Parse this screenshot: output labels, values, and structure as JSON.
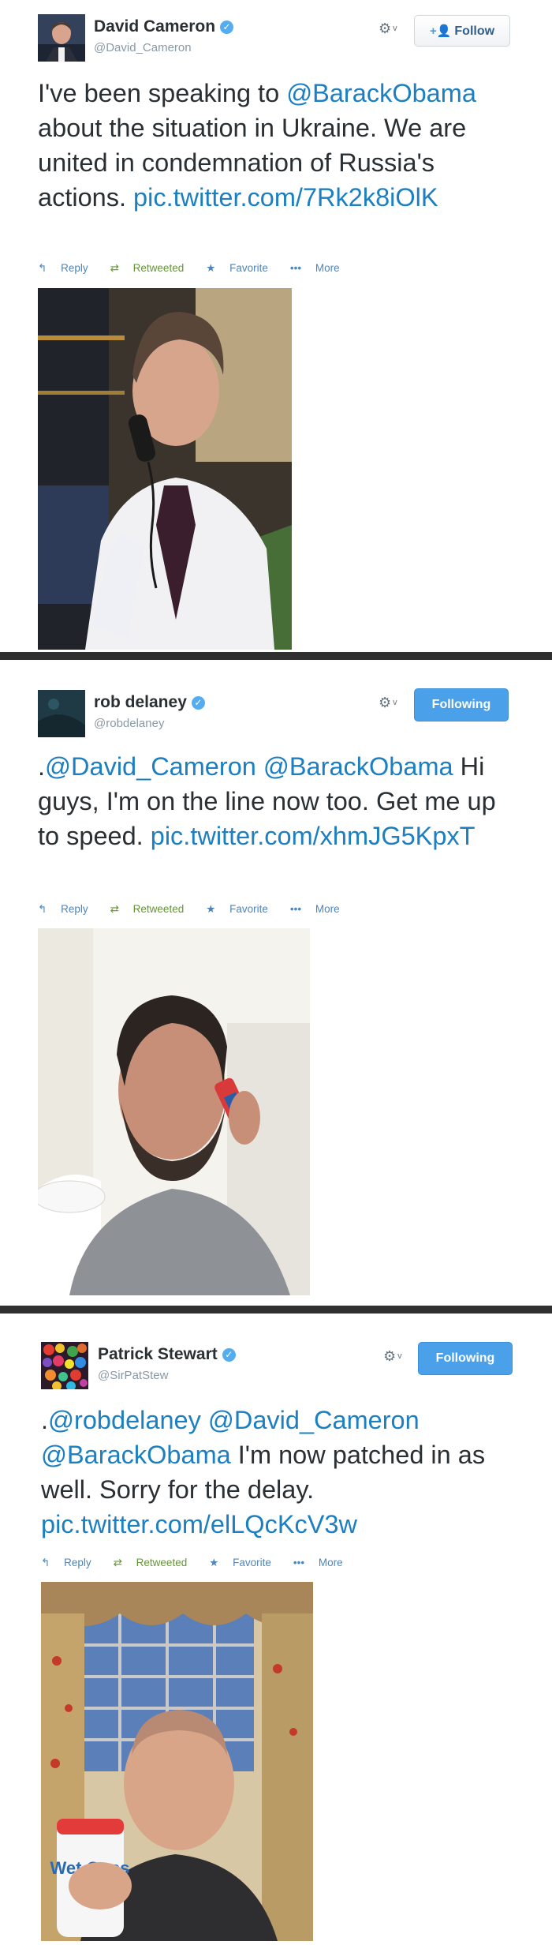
{
  "tweets": [
    {
      "name": "David Cameron",
      "handle": "@David_Cameron",
      "follow_label": "Follow",
      "text_segments": [
        {
          "t": "I've been speaking to ",
          "link": false
        },
        {
          "t": "@BarackObama",
          "link": true
        },
        {
          "t": " about the situation in Ukraine. We are united in condemnation of Russia's actions. ",
          "link": false
        },
        {
          "t": "pic.twitter.com/7Rk2k8iOlK",
          "link": true
        }
      ],
      "actions": {
        "reply": "Reply",
        "retweeted": "Retweeted",
        "favorite": "Favorite",
        "more": "More"
      }
    },
    {
      "name": "rob delaney",
      "handle": "@robdelaney",
      "follow_label": "Following",
      "text_segments": [
        {
          "t": ".",
          "link": false
        },
        {
          "t": "@David_Cameron",
          "link": true
        },
        {
          "t": " ",
          "link": false
        },
        {
          "t": "@BarackObama",
          "link": true
        },
        {
          "t": " Hi guys, I'm on the line now too. Get me up to speed. ",
          "link": false
        },
        {
          "t": "pic.twitter.com/xhmJG5KpxT",
          "link": true
        }
      ],
      "actions": {
        "reply": "Reply",
        "retweeted": "Retweeted",
        "favorite": "Favorite",
        "more": "More"
      }
    },
    {
      "name": "Patrick Stewart",
      "handle": "@SirPatStew",
      "follow_label": "Following",
      "text_segments": [
        {
          "t": ".",
          "link": false
        },
        {
          "t": "@robdelaney",
          "link": true
        },
        {
          "t": " ",
          "link": false
        },
        {
          "t": "@David_Cameron",
          "link": true
        },
        {
          "t": " ",
          "link": false
        },
        {
          "t": "@BarackObama",
          "link": true
        },
        {
          "t": " I'm now patched in as well. Sorry for the delay. ",
          "link": false
        },
        {
          "t": "pic.twitter.com/elLQcKcV3w",
          "link": true
        }
      ],
      "actions": {
        "reply": "Reply",
        "retweeted": "Retweeted",
        "favorite": "Favorite",
        "more": "More"
      },
      "product_label": "Wet Ones"
    }
  ],
  "icons": {
    "verified": "verified-badge-icon",
    "gear": "gear-icon",
    "reply": "reply-icon",
    "retweet": "retweet-icon",
    "favorite": "star-icon",
    "more": "more-dots-icon",
    "add_user": "add-user-icon"
  },
  "colors": {
    "link": "#1b7fc1",
    "following_button": "#4aa1e9",
    "retweeted": "#609928",
    "divider": "#303030"
  }
}
